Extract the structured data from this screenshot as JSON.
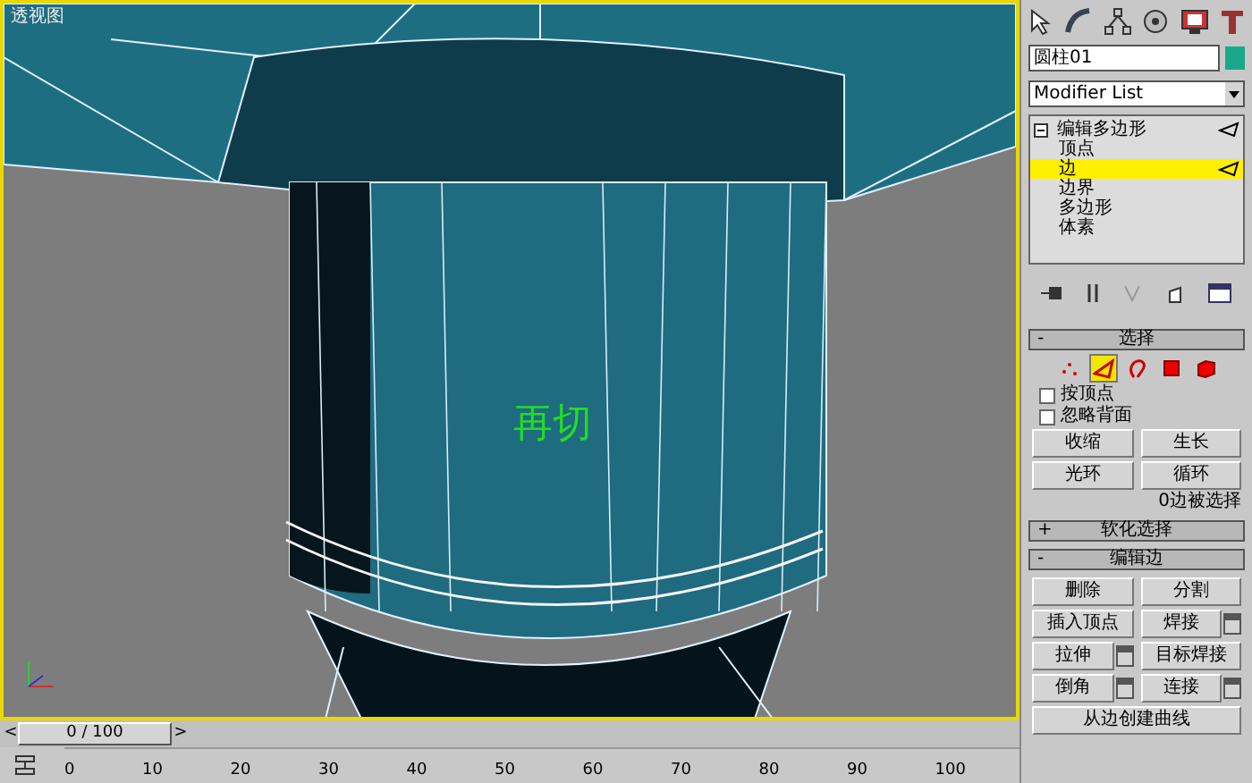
{
  "viewport": {
    "label": "透视图",
    "annotation": "再切"
  },
  "command_panel": {
    "object_name": "圆柱01",
    "modifier_list": "Modifier List",
    "stack": [
      {
        "label": "编辑多边形",
        "selected": false,
        "children": [
          {
            "label": "顶点",
            "selected": false
          },
          {
            "label": "边",
            "selected": true
          },
          {
            "label": "边界",
            "selected": false
          },
          {
            "label": "多边形",
            "selected": false
          },
          {
            "label": "体素",
            "selected": false
          }
        ]
      }
    ]
  },
  "rollouts": [
    {
      "kind": "selection",
      "sign": "-",
      "title": "选择",
      "modes": [
        {
          "kind": "vertex",
          "selected": false
        },
        {
          "kind": "edge",
          "selected": true
        },
        {
          "kind": "border",
          "selected": false
        },
        {
          "kind": "polygon",
          "selected": false
        },
        {
          "kind": "element",
          "selected": false
        }
      ],
      "checkboxes": [
        {
          "label": "按顶点",
          "checked": false
        },
        {
          "label": "忽略背面",
          "checked": false
        }
      ],
      "buttons": [
        {
          "label": "收缩",
          "settings": false
        },
        {
          "label": "生长",
          "settings": false
        },
        {
          "label": "光环",
          "settings": false
        },
        {
          "label": "循环",
          "settings": false
        }
      ],
      "status": "0边被选择"
    },
    {
      "kind": "header",
      "sign": "+",
      "title": "软化选择"
    },
    {
      "kind": "edit",
      "sign": "-",
      "title": "编辑边",
      "buttons": [
        {
          "label": "删除",
          "settings": false
        },
        {
          "label": "分割",
          "settings": false
        },
        {
          "label": "插入顶点",
          "settings": false
        },
        {
          "label": "焊接",
          "settings": true
        },
        {
          "label": "拉伸",
          "settings": true
        },
        {
          "label": "目标焊接",
          "settings": false
        },
        {
          "label": "倒角",
          "settings": true
        },
        {
          "label": "连接",
          "settings": true
        }
      ],
      "wide_button": "从边创建曲线"
    }
  ],
  "time_slider": {
    "prev": "<",
    "position": "0 / 100",
    "next": ">"
  },
  "track_bar": {
    "ticks": [
      "0",
      "10",
      "20",
      "30",
      "40",
      "50",
      "60",
      "70",
      "80",
      "90",
      "100"
    ]
  }
}
